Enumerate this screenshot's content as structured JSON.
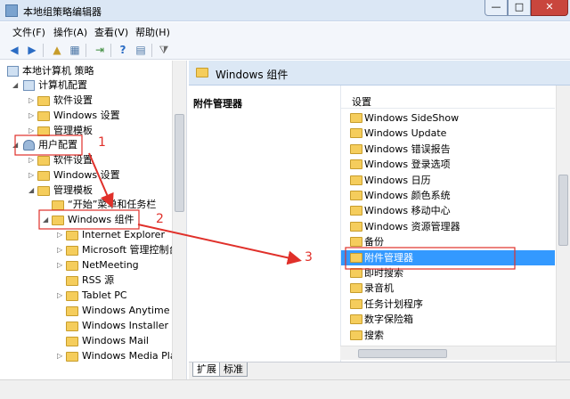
{
  "window": {
    "title": "本地组策略编辑器",
    "min": "—",
    "max": "□",
    "close": "✕"
  },
  "menu": [
    "文件(F)",
    "操作(A)",
    "查看(V)",
    "帮助(H)"
  ],
  "toolbar_icons": [
    "back-icon",
    "forward-icon",
    "up-folder-icon",
    "show-hide-tree-icon",
    "export-icon",
    "help-icon",
    "properties-icon",
    "filter-icon"
  ],
  "tree": {
    "root": "本地计算机 策略",
    "computer_config": "计算机配置",
    "cc_items": [
      "软件设置",
      "Windows 设置",
      "管理模板"
    ],
    "user_config": "用户配置",
    "uc_items": [
      "软件设置",
      "Windows 设置",
      "管理模板"
    ],
    "start_menu": "“开始”菜单和任务栏",
    "windows_components": "Windows 组件",
    "wc_items": [
      "Internet Explorer",
      "Microsoft 管理控制台",
      "NetMeeting",
      "RSS 源",
      "Tablet PC",
      "Windows Anytime Up",
      "Windows Installer",
      "Windows Mail",
      "Windows Media Play"
    ]
  },
  "right_header": {
    "title": "Windows 组件"
  },
  "description": {
    "title": "附件管理器"
  },
  "list": {
    "header": "设置",
    "items": [
      "Windows SideShow",
      "Windows Update",
      "Windows 错误报告",
      "Windows 登录选项",
      "Windows 日历",
      "Windows 颜色系统",
      "Windows 移动中心",
      "Windows 资源管理器",
      "备份",
      "附件管理器",
      "即时搜索",
      "录音机",
      "任务计划程序",
      "数字保险箱",
      "搜索"
    ],
    "selected_index": 9
  },
  "tabs": [
    "扩展",
    "标准"
  ],
  "annotations": [
    "1",
    "2",
    "3"
  ],
  "colors": {
    "selection": "#3399ff",
    "annotation": "#e0302a",
    "folder": "#f5cd5c"
  }
}
